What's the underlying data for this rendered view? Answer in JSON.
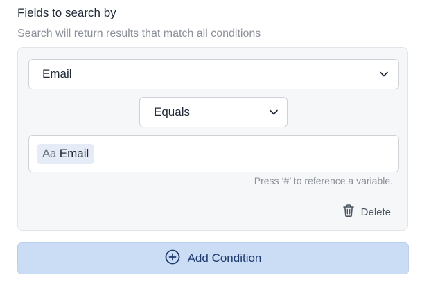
{
  "section": {
    "title": "Fields to search by",
    "subtitle": "Search will return results that match all conditions"
  },
  "condition": {
    "field_select": {
      "value": "Email",
      "icon": "chevron-down-icon"
    },
    "operator_select": {
      "value": "Equals",
      "icon": "chevron-down-icon"
    },
    "value_input": {
      "token": {
        "type_icon": "Aa",
        "label": "Email"
      }
    },
    "hint": "Press ‘#’ to reference a variable.",
    "delete": {
      "label": "Delete",
      "icon": "trash-icon"
    }
  },
  "add_condition": {
    "label": "Add Condition",
    "icon": "plus-circle-icon"
  },
  "colors": {
    "accent_bg": "#cbdcf5",
    "accent_text": "#1e3a6e",
    "card_bg": "#f6f7f8",
    "chip_bg": "#e6ecf7"
  }
}
